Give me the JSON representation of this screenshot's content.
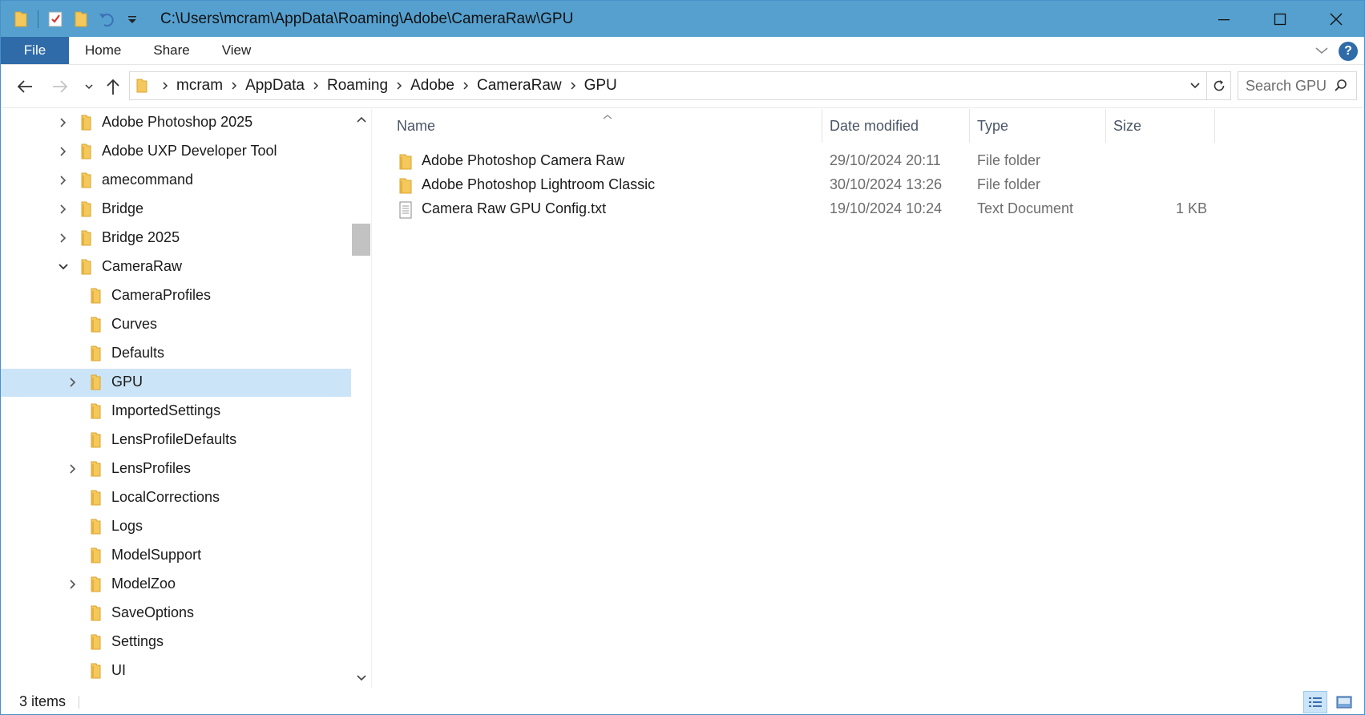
{
  "titlebar": {
    "path": "C:\\Users\\mcram\\AppData\\Roaming\\Adobe\\CameraRaw\\GPU"
  },
  "ribbon": {
    "tabs": [
      "File",
      "Home",
      "Share",
      "View"
    ]
  },
  "address": {
    "crumbs": [
      "mcram",
      "AppData",
      "Roaming",
      "Adobe",
      "CameraRaw",
      "GPU"
    ]
  },
  "search": {
    "placeholder": "Search GPU"
  },
  "tree": [
    {
      "label": "Adobe Photoshop 2025",
      "expander": "collapsed",
      "level": 0
    },
    {
      "label": "Adobe UXP Developer Tool",
      "expander": "collapsed",
      "level": 0
    },
    {
      "label": "amecommand",
      "expander": "collapsed",
      "level": 0
    },
    {
      "label": "Bridge",
      "expander": "collapsed",
      "level": 0
    },
    {
      "label": "Bridge 2025",
      "expander": "collapsed",
      "level": 0
    },
    {
      "label": "CameraRaw",
      "expander": "expanded",
      "level": 0
    },
    {
      "label": "CameraProfiles",
      "expander": "none",
      "level": 1
    },
    {
      "label": "Curves",
      "expander": "none",
      "level": 1
    },
    {
      "label": "Defaults",
      "expander": "none",
      "level": 1
    },
    {
      "label": "GPU",
      "expander": "collapsed",
      "level": 1,
      "selected": true
    },
    {
      "label": "ImportedSettings",
      "expander": "none",
      "level": 1
    },
    {
      "label": "LensProfileDefaults",
      "expander": "none",
      "level": 1
    },
    {
      "label": "LensProfiles",
      "expander": "collapsed",
      "level": 1
    },
    {
      "label": "LocalCorrections",
      "expander": "none",
      "level": 1
    },
    {
      "label": "Logs",
      "expander": "none",
      "level": 1
    },
    {
      "label": "ModelSupport",
      "expander": "none",
      "level": 1
    },
    {
      "label": "ModelZoo",
      "expander": "collapsed",
      "level": 1
    },
    {
      "label": "SaveOptions",
      "expander": "none",
      "level": 1
    },
    {
      "label": "Settings",
      "expander": "none",
      "level": 1
    },
    {
      "label": "UI",
      "expander": "none",
      "level": 1
    }
  ],
  "columns": {
    "name": "Name",
    "date": "Date modified",
    "type": "Type",
    "size": "Size"
  },
  "files": [
    {
      "name": "Adobe Photoshop Camera Raw",
      "date": "29/10/2024 20:11",
      "type": "File folder",
      "size": "",
      "icon": "folder-icon"
    },
    {
      "name": "Adobe Photoshop Lightroom Classic",
      "date": "30/10/2024 13:26",
      "type": "File folder",
      "size": "",
      "icon": "folder-icon"
    },
    {
      "name": "Camera Raw GPU Config.txt",
      "date": "19/10/2024 10:24",
      "type": "Text Document",
      "size": "1 KB",
      "icon": "text-file-icon"
    }
  ],
  "status": {
    "items": "3 items"
  },
  "colors": {
    "titlebar": "#55a0cf",
    "file_tab": "#2e6ba8",
    "selection": "#cce4f7",
    "folder": "#f5c85b"
  }
}
